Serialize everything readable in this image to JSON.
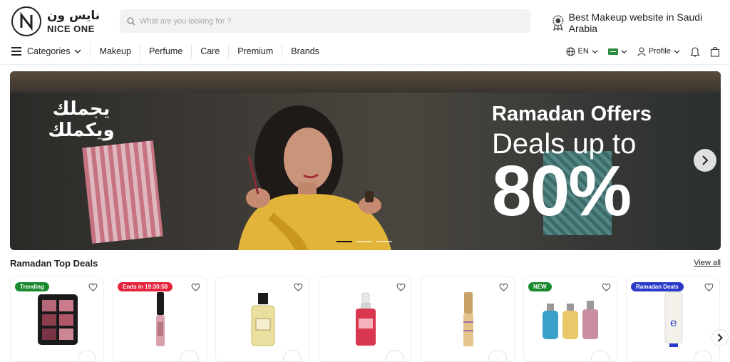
{
  "brand": {
    "name_ar": "نايس ون",
    "name_en": "NICE ONE",
    "logo_letter": "N"
  },
  "search": {
    "placeholder": "What are you looking for ?"
  },
  "tagline": "Best Makeup website in Saudi Arabia",
  "nav": {
    "categories_label": "Categories",
    "items": [
      "Makeup",
      "Perfume",
      "Care",
      "Premium",
      "Brands"
    ],
    "language": "EN",
    "profile": "Profile"
  },
  "banner": {
    "arabic_line1": "يجملك",
    "arabic_line2": "ويكملك",
    "title": "Ramadan Offers",
    "subtitle": "Deals up to",
    "percent": "80%",
    "slides": 3,
    "active_slide": 1
  },
  "deals": {
    "title": "Ramadan Top Deals",
    "view_all": "View all",
    "cards": [
      {
        "badge": "Trending",
        "badge_color": "#1a8a2e",
        "product": "eyeshadow-palette-icon"
      },
      {
        "badge": "Ends in 19:30:58",
        "badge_color": "#e5243b",
        "product": "mascara-icon"
      },
      {
        "badge": "",
        "badge_color": "",
        "product": "perfume-bottle-icon"
      },
      {
        "badge": "",
        "badge_color": "",
        "product": "serum-dropper-icon"
      },
      {
        "badge": "",
        "badge_color": "",
        "product": "concealer-tube-icon"
      },
      {
        "badge": "NEW",
        "badge_color": "#1a8a2e",
        "product": "perfume-set-icon"
      },
      {
        "badge": "Ramadan Deals",
        "badge_color": "#2b3bc9",
        "product": "cream-tube-icon"
      }
    ]
  },
  "colors": {
    "accent": "#1a8a2e",
    "text": "#222222",
    "search_bg": "#f2f2f2"
  }
}
